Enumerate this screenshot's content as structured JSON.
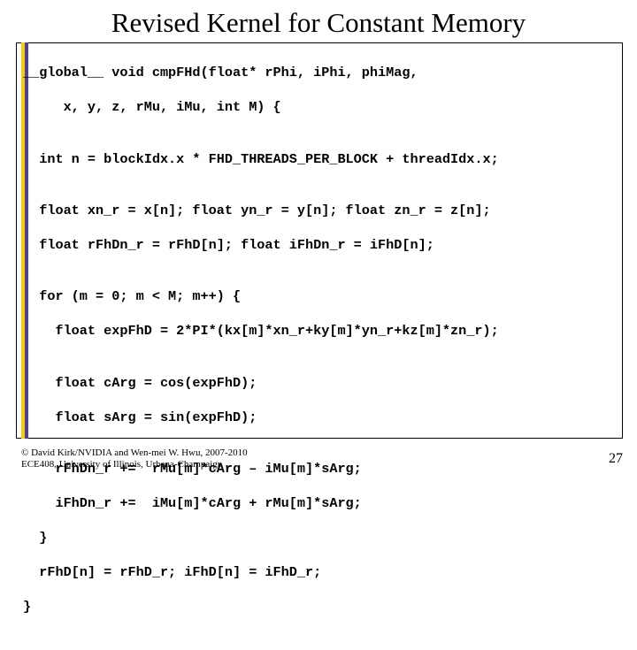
{
  "title": "Revised Kernel for Constant Memory",
  "code": [
    "__global__ void cmpFHd(float* rPhi, iPhi, phiMag,",
    "     x, y, z, rMu, iMu, int M) {",
    "",
    "  int n = blockIdx.x * FHD_THREADS_PER_BLOCK + threadIdx.x;",
    "",
    "  float xn_r = x[n]; float yn_r = y[n]; float zn_r = z[n];",
    "  float rFhDn_r = rFhD[n]; float iFhDn_r = iFhD[n];",
    "",
    "  for (m = 0; m < M; m++) {",
    "    float expFhD = 2*PI*(kx[m]*xn_r+ky[m]*yn_r+kz[m]*zn_r);",
    "",
    "    float cArg = cos(expFhD);",
    "    float sArg = sin(expFhD);",
    "",
    "    rFhDn_r +=  rMu[m]*cArg – iMu[m]*sArg;",
    "    iFhDn_r +=  iMu[m]*cArg + rMu[m]*sArg;",
    "  }",
    "  rFhD[n] = rFhD_r; iFhD[n] = iFhD_r;",
    "}"
  ],
  "footer": {
    "line1": "© David Kirk/NVIDIA and Wen-mei W. Hwu, 2007-2010",
    "line2": "ECE408, University of Illinois, Urbana-Champaign"
  },
  "pagenum": "27"
}
